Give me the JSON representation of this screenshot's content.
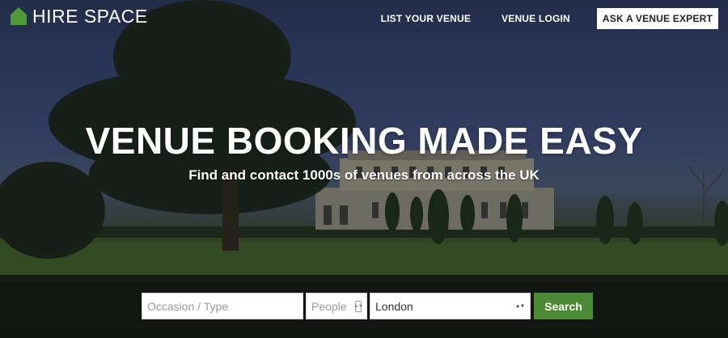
{
  "brand": {
    "name": "HIRE SPACE",
    "accent": "#4e9a3a"
  },
  "nav": {
    "items": [
      "LIST YOUR VENUE",
      "VENUE LOGIN"
    ],
    "cta": "ASK A VENUE EXPERT"
  },
  "hero": {
    "headline": "VENUE BOOKING MADE EASY",
    "subheadline": "Find and contact 1000s of venues from across the UK"
  },
  "search": {
    "occasion_placeholder": "Occasion / Type",
    "people_placeholder": "People",
    "location_value": "London",
    "button_label": "Search",
    "button_color": "#4e8a35"
  }
}
